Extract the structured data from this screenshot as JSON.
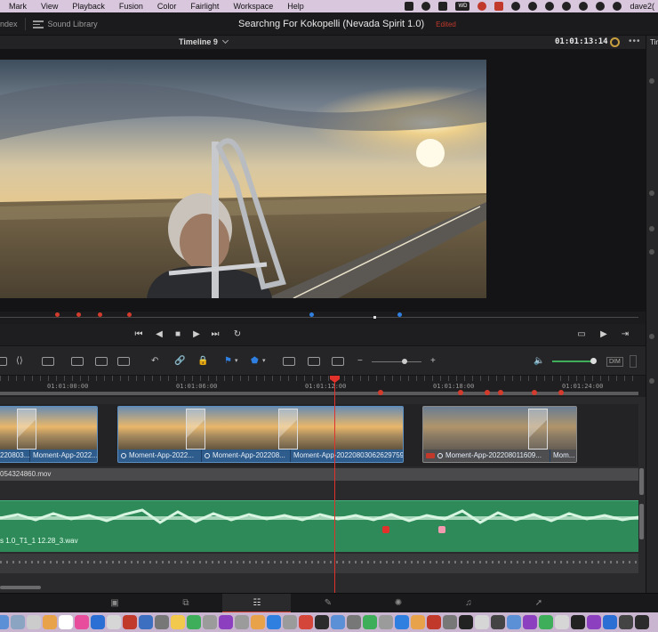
{
  "menubar": {
    "items": [
      "Mark",
      "View",
      "Playback",
      "Fusion",
      "Color",
      "Fairlight",
      "Workspace",
      "Help"
    ],
    "tray_wd_label": "WD",
    "user": "dave2("
  },
  "header": {
    "index_label": "ndex",
    "sound_library_label": "Sound Library",
    "project_title": "Searchng For Kokopelli (Nevada Spirit 1.0)",
    "edited_label": "Edited"
  },
  "viewer": {
    "timeline_name": "Timeline 9",
    "timecode": "01:01:13:14",
    "more_label": "•••"
  },
  "inspector": {
    "label": "Tir"
  },
  "ruler": {
    "timecodes": [
      "01:01:00:00",
      "01:01:06:00",
      "01:01:12:00",
      "01:01:18:00",
      "01:01:24:00"
    ]
  },
  "timeline": {
    "clips_v2": [
      {
        "segments": [
          "220803...",
          "Moment-App-2022..."
        ]
      },
      {
        "segments": [
          "Moment-App-2022...",
          "Moment-App-202208...",
          "Moment-App-20220803062629759..."
        ]
      },
      {
        "segments": [
          "Moment-App-202208011609...",
          "Mom..."
        ]
      }
    ],
    "v1_clip_label": "054324860.mov",
    "audio_clip_label": "s 1.0_T1_1 12.28_3.wav"
  },
  "toolbar": {
    "dim_label": "DIM"
  },
  "colors": {
    "accent_red": "#e0322a",
    "clip_blue": "#3f6f9f",
    "audio_green": "#2f8a5a",
    "marker_blue": "#2f7fe0"
  }
}
